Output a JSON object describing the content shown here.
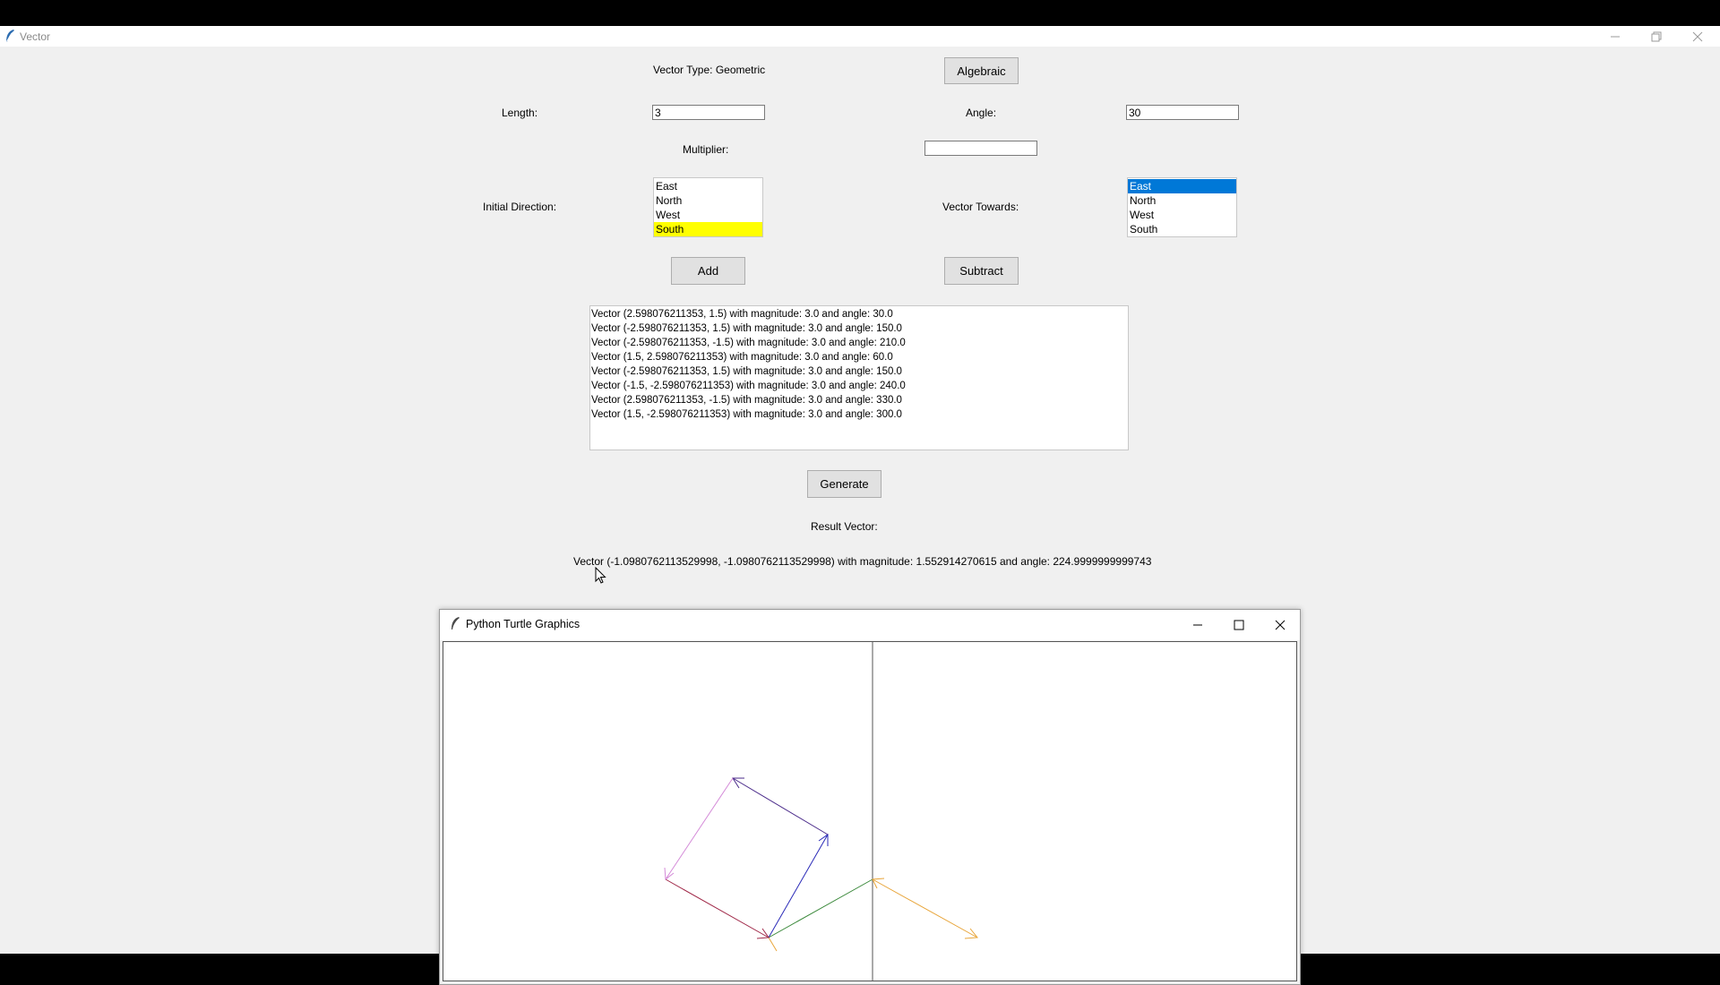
{
  "window": {
    "title": "Vector"
  },
  "form": {
    "vector_type_label": "Vector Type: Geometric",
    "type_toggle_button": "Algebraic",
    "length_label": "Length:",
    "length_value": "3",
    "angle_label": "Angle:",
    "angle_value": "30",
    "multiplier_label": "Multiplier:",
    "multiplier_value": "",
    "initial_direction_label": "Initial Direction:",
    "initial_direction_options": [
      "East",
      "North",
      "West",
      "South"
    ],
    "initial_direction_selected": "South",
    "vector_towards_label": "Vector Towards:",
    "vector_towards_options": [
      "East",
      "North",
      "West",
      "South"
    ],
    "vector_towards_selected": "East",
    "add_button": "Add",
    "subtract_button": "Subtract"
  },
  "vector_list": [
    "Vector (2.598076211353, 1.5) with magnitude: 3.0 and angle: 30.0",
    "Vector (-2.598076211353, 1.5) with magnitude: 3.0 and angle: 150.0",
    "Vector (-2.598076211353, -1.5) with magnitude: 3.0 and angle: 210.0",
    "Vector (1.5, 2.598076211353) with magnitude: 3.0 and angle: 60.0",
    "Vector (-2.598076211353, 1.5) with magnitude: 3.0 and angle: 150.0",
    "Vector (-1.5, -2.598076211353) with magnitude: 3.0 and angle: 240.0",
    "Vector (2.598076211353, -1.5) with magnitude: 3.0 and angle: 330.0",
    "Vector (1.5, -2.598076211353) with magnitude: 3.0 and angle: 300.0"
  ],
  "generate_button": "Generate",
  "result_label": "Result Vector:",
  "result_value": "Vector (-1.0980762113529998, -1.0980762113529998) with magnitude: 1.552914270615 and angle: 224.9999999999743",
  "turtle_window": {
    "title": "Python Turtle Graphics"
  },
  "colors": {
    "selected_initial": "#ffff00",
    "selected_towards": "#0078d7",
    "arrow_orange": "#e8a53a",
    "arrow_green": "#3c8a3c",
    "arrow_blue": "#2a2ab8",
    "arrow_purple": "#4a2a8a",
    "arrow_pink": "#d48ad8",
    "arrow_red": "#a02848"
  },
  "icons": [
    "feather-icon",
    "minimize-icon",
    "restore-icon",
    "maximize-icon",
    "close-icon",
    "mouse-cursor-icon"
  ]
}
